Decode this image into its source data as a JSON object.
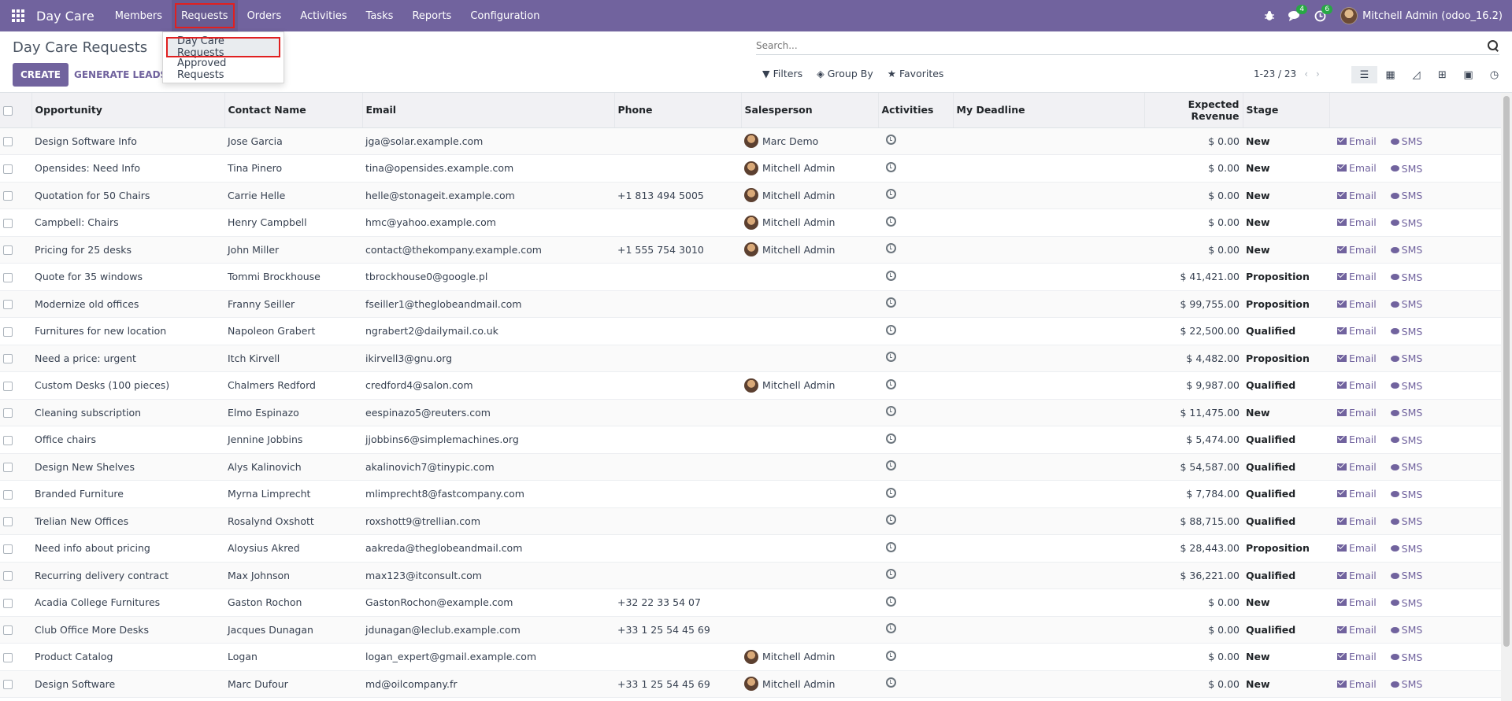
{
  "navbar": {
    "app_name": "Day Care",
    "menu": [
      "Members",
      "Requests",
      "Orders",
      "Activities",
      "Tasks",
      "Reports",
      "Configuration"
    ],
    "chat_badge": "4",
    "activity_badge": "6",
    "user_name": "Mitchell Admin (odoo_16.2)"
  },
  "dropdown": {
    "items": [
      "Day Care Requests",
      "Approved Requests"
    ]
  },
  "control": {
    "breadcrumb": "Day Care Requests",
    "create_label": "CREATE",
    "generate_label": "GENERATE LEADS",
    "search_placeholder": "Search...",
    "filters_label": "Filters",
    "groupby_label": "Group By",
    "favorites_label": "Favorites",
    "pager": "1-23 / 23"
  },
  "table": {
    "columns": [
      "Opportunity",
      "Contact Name",
      "Email",
      "Phone",
      "Salesperson",
      "Activities",
      "My Deadline",
      "Expected Revenue",
      "Stage"
    ],
    "email_action": "Email",
    "sms_action": "SMS",
    "rows": [
      {
        "opportunity": "Design Software Info",
        "contact": "Jose Garcia",
        "email": "jga@solar.example.com",
        "phone": "",
        "salesperson": "Marc Demo",
        "revenue": "$ 0.00",
        "stage": "New"
      },
      {
        "opportunity": "Opensides: Need Info",
        "contact": "Tina Pinero",
        "email": "tina@opensides.example.com",
        "phone": "",
        "salesperson": "Mitchell Admin",
        "revenue": "$ 0.00",
        "stage": "New"
      },
      {
        "opportunity": "Quotation for 50 Chairs",
        "contact": "Carrie Helle",
        "email": "helle@stonageit.example.com",
        "phone": "+1 813 494 5005",
        "salesperson": "Mitchell Admin",
        "revenue": "$ 0.00",
        "stage": "New"
      },
      {
        "opportunity": "Campbell: Chairs",
        "contact": "Henry Campbell",
        "email": "hmc@yahoo.example.com",
        "phone": "",
        "salesperson": "Mitchell Admin",
        "revenue": "$ 0.00",
        "stage": "New"
      },
      {
        "opportunity": "Pricing for 25 desks",
        "contact": "John Miller",
        "email": "contact@thekompany.example.com",
        "phone": "+1 555 754 3010",
        "salesperson": "Mitchell Admin",
        "revenue": "$ 0.00",
        "stage": "New"
      },
      {
        "opportunity": "Quote for 35 windows",
        "contact": "Tommi Brockhouse",
        "email": "tbrockhouse0@google.pl",
        "phone": "",
        "salesperson": "",
        "revenue": "$ 41,421.00",
        "stage": "Proposition"
      },
      {
        "opportunity": "Modernize old offices",
        "contact": "Franny Seiller",
        "email": "fseiller1@theglobeandmail.com",
        "phone": "",
        "salesperson": "",
        "revenue": "$ 99,755.00",
        "stage": "Proposition"
      },
      {
        "opportunity": "Furnitures for new location",
        "contact": "Napoleon Grabert",
        "email": "ngrabert2@dailymail.co.uk",
        "phone": "",
        "salesperson": "",
        "revenue": "$ 22,500.00",
        "stage": "Qualified"
      },
      {
        "opportunity": "Need a price: urgent",
        "contact": "Itch Kirvell",
        "email": "ikirvell3@gnu.org",
        "phone": "",
        "salesperson": "",
        "revenue": "$ 4,482.00",
        "stage": "Proposition"
      },
      {
        "opportunity": "Custom Desks (100 pieces)",
        "contact": "Chalmers Redford",
        "email": "credford4@salon.com",
        "phone": "",
        "salesperson": "Mitchell Admin",
        "revenue": "$ 9,987.00",
        "stage": "Qualified"
      },
      {
        "opportunity": "Cleaning subscription",
        "contact": "Elmo Espinazo",
        "email": "eespinazo5@reuters.com",
        "phone": "",
        "salesperson": "",
        "revenue": "$ 11,475.00",
        "stage": "New"
      },
      {
        "opportunity": "Office chairs",
        "contact": "Jennine Jobbins",
        "email": "jjobbins6@simplemachines.org",
        "phone": "",
        "salesperson": "",
        "revenue": "$ 5,474.00",
        "stage": "Qualified"
      },
      {
        "opportunity": "Design New Shelves",
        "contact": "Alys Kalinovich",
        "email": "akalinovich7@tinypic.com",
        "phone": "",
        "salesperson": "",
        "revenue": "$ 54,587.00",
        "stage": "Qualified"
      },
      {
        "opportunity": "Branded Furniture",
        "contact": "Myrna Limprecht",
        "email": "mlimprecht8@fastcompany.com",
        "phone": "",
        "salesperson": "",
        "revenue": "$ 7,784.00",
        "stage": "Qualified"
      },
      {
        "opportunity": "Trelian New Offices",
        "contact": "Rosalynd Oxshott",
        "email": "roxshott9@trellian.com",
        "phone": "",
        "salesperson": "",
        "revenue": "$ 88,715.00",
        "stage": "Qualified"
      },
      {
        "opportunity": "Need info about pricing",
        "contact": "Aloysius Akred",
        "email": "aakreda@theglobeandmail.com",
        "phone": "",
        "salesperson": "",
        "revenue": "$ 28,443.00",
        "stage": "Proposition"
      },
      {
        "opportunity": "Recurring delivery contract",
        "contact": "Max Johnson",
        "email": "max123@itconsult.com",
        "phone": "",
        "salesperson": "",
        "revenue": "$ 36,221.00",
        "stage": "Qualified"
      },
      {
        "opportunity": "Acadia College Furnitures",
        "contact": "Gaston Rochon",
        "email": "GastonRochon@example.com",
        "phone": "+32 22 33 54 07",
        "salesperson": "",
        "revenue": "$ 0.00",
        "stage": "New"
      },
      {
        "opportunity": "Club Office More Desks",
        "contact": "Jacques Dunagan",
        "email": "jdunagan@leclub.example.com",
        "phone": "+33 1 25 54 45 69",
        "salesperson": "",
        "revenue": "$ 0.00",
        "stage": "Qualified"
      },
      {
        "opportunity": "Product Catalog",
        "contact": "Logan",
        "email": "logan_expert@gmail.example.com",
        "phone": "",
        "salesperson": "Mitchell Admin",
        "revenue": "$ 0.00",
        "stage": "New"
      },
      {
        "opportunity": "Design Software",
        "contact": "Marc Dufour",
        "email": "md@oilcompany.fr",
        "phone": "+33 1 25 54 45 69",
        "salesperson": "Mitchell Admin",
        "revenue": "$ 0.00",
        "stage": "New"
      }
    ]
  }
}
